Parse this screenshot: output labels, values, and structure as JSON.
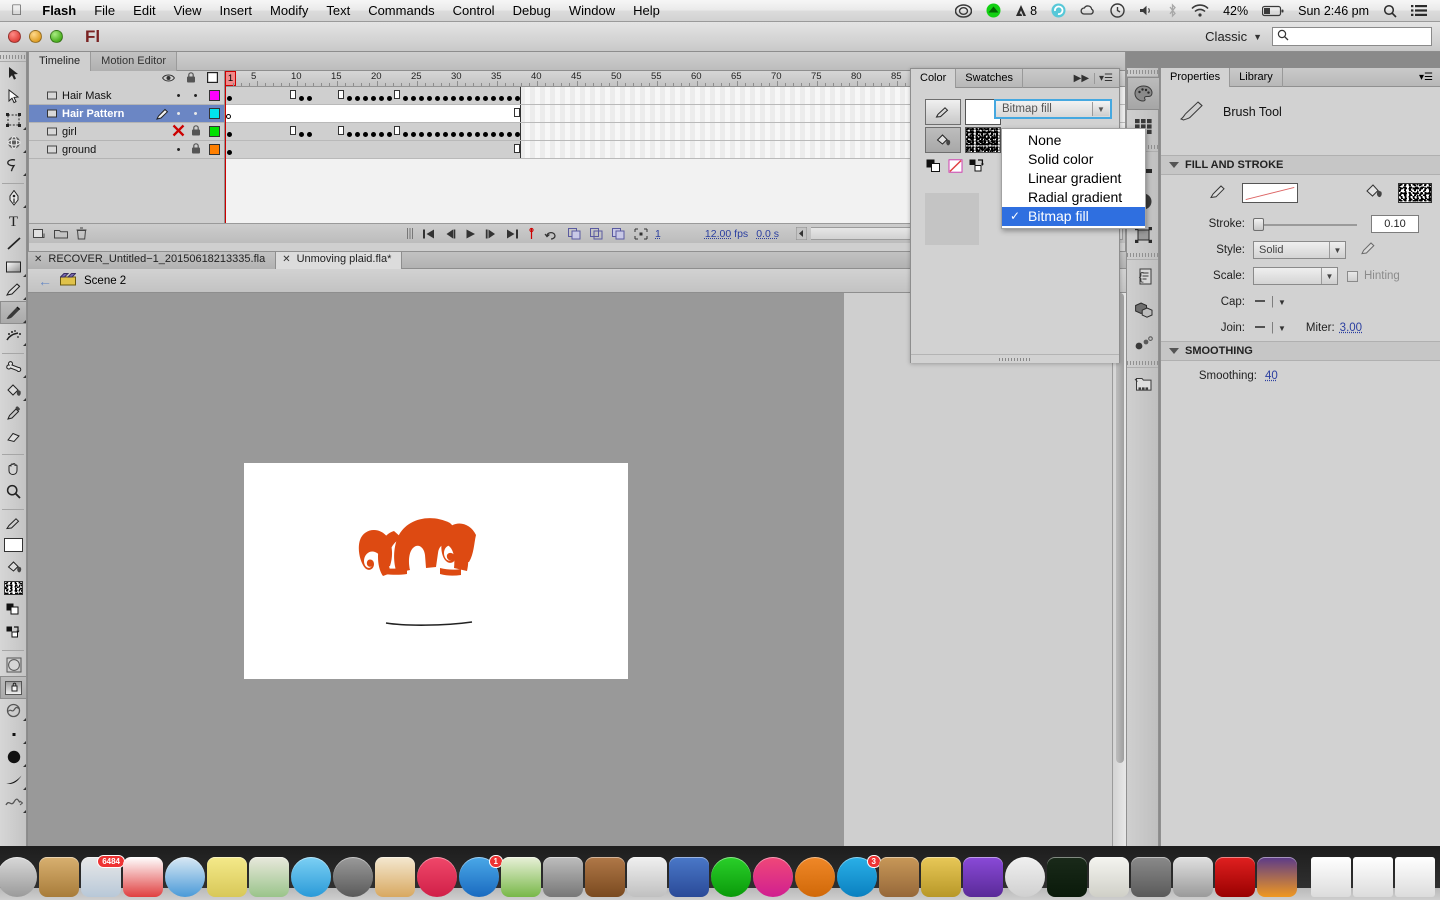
{
  "menubar": {
    "apple_icon": "apple-icon",
    "items": [
      "Flash",
      "File",
      "Edit",
      "View",
      "Insert",
      "Modify",
      "Text",
      "Commands",
      "Control",
      "Debug",
      "Window",
      "Help"
    ],
    "status": {
      "creative_cloud_icon": "creative-cloud-icon",
      "dropbox_icon": "dropbox-icon",
      "adobe_icon": "adobe-icon",
      "adobe_count": "8",
      "sync_icon": "sync-icon",
      "cloud_icon": "cloud-icon",
      "timemachine_icon": "time-machine-icon",
      "volume_icon": "volume-icon",
      "bluetooth_icon": "bluetooth-icon",
      "wifi_icon": "wifi-icon",
      "battery_percent": "42%",
      "battery_icon": "battery-icon",
      "clock": "Sun 2:46 pm",
      "spotlight_icon": "search-icon",
      "notification_icon": "notification-center-icon"
    }
  },
  "titlebar": {
    "app_logo": "Fl",
    "workspace": "Classic",
    "workspace_arrow_icon": "chevron-down-icon",
    "search_icon": "search-icon",
    "search_value": "",
    "search_placeholder": ""
  },
  "toolbar": {
    "tools": [
      {
        "name": "selection-tool",
        "icon": "arrow-icon",
        "selected": false,
        "submenu": false
      },
      {
        "name": "subselection-tool",
        "icon": "white-arrow-icon",
        "selected": false,
        "submenu": false
      },
      {
        "name": "free-transform-tool",
        "icon": "transform-icon",
        "selected": false,
        "submenu": true
      },
      {
        "name": "3d-rotation-tool",
        "icon": "sphere-icon",
        "selected": false,
        "submenu": true
      },
      {
        "name": "lasso-tool",
        "icon": "lasso-icon",
        "selected": false,
        "submenu": true
      },
      {
        "name": "pen-tool",
        "icon": "pen-nib-icon",
        "selected": false,
        "submenu": true
      },
      {
        "name": "text-tool",
        "icon": "text-t-icon",
        "selected": false,
        "submenu": false
      },
      {
        "name": "line-tool",
        "icon": "line-icon",
        "selected": false,
        "submenu": false
      },
      {
        "name": "rectangle-tool",
        "icon": "rectangle-icon",
        "selected": false,
        "submenu": true
      },
      {
        "name": "pencil-tool",
        "icon": "pencil-icon",
        "selected": false,
        "submenu": true
      },
      {
        "name": "brush-tool",
        "icon": "brush-icon",
        "selected": true,
        "submenu": true
      },
      {
        "name": "deco-tool",
        "icon": "deco-spray-icon",
        "selected": false,
        "submenu": true
      },
      {
        "name": "bone-tool",
        "icon": "bone-icon",
        "selected": false,
        "submenu": true
      },
      {
        "name": "paint-bucket-tool",
        "icon": "paint-bucket-icon",
        "selected": false,
        "submenu": true
      },
      {
        "name": "eyedropper-tool",
        "icon": "eyedropper-icon",
        "selected": false,
        "submenu": false
      },
      {
        "name": "eraser-tool",
        "icon": "eraser-icon",
        "selected": false,
        "submenu": false
      },
      {
        "name": "hand-tool",
        "icon": "hand-icon",
        "selected": false,
        "submenu": false
      },
      {
        "name": "zoom-tool",
        "icon": "magnifier-icon",
        "selected": false,
        "submenu": false
      }
    ],
    "colors": {
      "stroke_icon": "pencil-stroke-icon",
      "stroke_color": "#ffffff",
      "fill_icon": "paint-bucket-icon",
      "fill_swatch": "bitmap-fill-icon",
      "black_white_icon": "black-white-reset-icon",
      "swap_icon": "swap-colors-icon"
    },
    "options": {
      "object_drawing_icon": "object-drawing-icon",
      "lock_fill_icon": "lock-fill-icon",
      "brush_size_small_icon": "brush-size-small-icon",
      "brush_size_large_icon": "brush-size-large-icon",
      "brush_shape_icon": "brush-shape-icon",
      "smoothing_icon": "smoothing-icon"
    }
  },
  "timeline": {
    "tabs": [
      {
        "label": "Timeline",
        "active": true
      },
      {
        "label": "Motion Editor",
        "active": false
      }
    ],
    "header_icons": {
      "eye": "eye-icon",
      "lock": "lock-icon",
      "outline": "outline-square-icon"
    },
    "layers": [
      {
        "name": "Hair Mask",
        "visible": true,
        "locked": false,
        "color": "#ff00ff",
        "selected": false,
        "editing": false
      },
      {
        "name": "Hair Pattern",
        "visible": true,
        "locked": false,
        "color": "#00e5ee",
        "selected": true,
        "editing": true
      },
      {
        "name": "girl",
        "visible": false,
        "locked": true,
        "color": "#00e000",
        "selected": false,
        "editing": false
      },
      {
        "name": "ground",
        "visible": true,
        "locked": true,
        "color": "#ff7f00",
        "selected": false,
        "editing": false
      }
    ],
    "ruler_labels": [
      "1",
      "5",
      "10",
      "15",
      "20",
      "25",
      "30",
      "35",
      "40",
      "45",
      "50",
      "55",
      "60",
      "65",
      "70",
      "75",
      "80",
      "85"
    ],
    "playhead_frame": "1",
    "footer": {
      "new_layer_icon": "new-layer-icon",
      "new_folder_icon": "new-folder-icon",
      "delete_icon": "trash-icon",
      "first_frame_icon": "go-to-first-icon",
      "step_back_icon": "step-back-icon",
      "play_icon": "play-icon",
      "step_forward_icon": "step-forward-icon",
      "last_frame_icon": "go-to-last-icon",
      "center_frame_icon": "center-frame-icon",
      "loop_icon": "loop-icon",
      "onion_skin_icon": "onion-skin-icon",
      "onion_outline_icon": "onion-skin-outlines-icon",
      "edit_multiple_icon": "edit-multiple-frames-icon",
      "modify_markers_icon": "modify-onion-markers-icon",
      "current_frame": "1",
      "fps_value": "12.00",
      "fps_label": "fps",
      "elapsed": "0.0 s"
    }
  },
  "doctabs": [
    {
      "label": "RECOVER_Untitled−1_20150618213335.fla",
      "active": false,
      "close_icon": "close-icon"
    },
    {
      "label": "Unmoving plaid.fla*",
      "active": true,
      "close_icon": "close-icon"
    }
  ],
  "scenebar": {
    "back_icon": "back-arrow-icon",
    "scene_icon": "scene-clapper-icon",
    "scene_label": "Scene 2"
  },
  "stage": {
    "artwork_color": "#dd4a12",
    "ground_line_color": "#222222"
  },
  "color_panel": {
    "tabs": [
      {
        "label": "Color",
        "active": true
      },
      {
        "label": "Swatches",
        "active": false
      }
    ],
    "expand_icon": "double-chevron-right-icon",
    "menu_icon": "panel-menu-icon",
    "stroke_button_icon": "pencil-stroke-icon",
    "stroke_swatch_color": "#ffffff",
    "fill_button_icon": "paint-bucket-icon",
    "fill_swatch_icon": "bitmap-fill-icon",
    "reset_icon": "black-white-reset-icon",
    "nocolor_icon": "no-color-icon",
    "swap_icon": "swap-colors-icon",
    "fill_type_value": "Bitmap fill",
    "fill_type_arrow_icon": "chevron-down-icon",
    "dropdown_options": [
      {
        "label": "None",
        "checked": false
      },
      {
        "label": "Solid color",
        "checked": false
      },
      {
        "label": "Linear gradient",
        "checked": false
      },
      {
        "label": "Radial gradient",
        "checked": false
      },
      {
        "label": "Bitmap fill",
        "checked": true
      }
    ],
    "highlight_color": "#2f6fe0",
    "focus_border_color": "#45a8e0"
  },
  "icondock": [
    {
      "name": "color-panel-icon",
      "selected": true
    },
    {
      "name": "swatches-panel-icon",
      "selected": false
    },
    {
      "name": "align-panel-icon",
      "selected": false
    },
    {
      "name": "info-panel-icon",
      "selected": false
    },
    {
      "name": "transform-panel-icon",
      "selected": false
    },
    {
      "name": "code-snippets-icon",
      "selected": false
    },
    {
      "name": "components-panel-icon",
      "selected": false
    },
    {
      "name": "motion-presets-icon",
      "selected": false
    },
    {
      "name": "library-panel-icon",
      "selected": false
    }
  ],
  "properties": {
    "tabs": [
      {
        "label": "Properties",
        "active": true
      },
      {
        "label": "Library",
        "active": false
      }
    ],
    "menu_icon": "panel-menu-icon",
    "tool_icon": "brush-icon",
    "tool_name": "Brush Tool",
    "sections": {
      "fill_and_stroke": {
        "title": "FILL AND STROKE",
        "collapse_icon": "triangle-down-icon",
        "stroke_icon": "pencil-stroke-icon",
        "stroke_swatch": "none-diagonal-icon",
        "fill_icon": "paint-bucket-icon",
        "fill_swatch": "bitmap-fill-icon",
        "rows": [
          {
            "label": "Stroke:",
            "value": "0.10",
            "type": "slider-field"
          },
          {
            "label": "Style:",
            "value": "Solid",
            "type": "select",
            "edit_icon": "pencil-edit-icon"
          },
          {
            "label": "Scale:",
            "value": "",
            "type": "select",
            "checkbox_label": "Hinting",
            "checked": false
          },
          {
            "label": "Cap:",
            "value": "",
            "type": "icon-select",
            "icon": "cap-none-icon"
          },
          {
            "label": "Join:",
            "value": "",
            "type": "icon-select",
            "icon": "join-none-icon",
            "extra_label": "Miter:",
            "extra_value": "3.00"
          }
        ]
      },
      "smoothing": {
        "title": "SMOOTHING",
        "collapse_icon": "triangle-down-icon",
        "label": "Smoothing:",
        "value": "40"
      }
    }
  },
  "dock": {
    "items": [
      {
        "name": "finder-icon",
        "badge": null
      },
      {
        "name": "launchpad-icon",
        "badge": null
      },
      {
        "name": "contacts-icon",
        "badge": null
      },
      {
        "name": "mail-icon",
        "badge": "6484"
      },
      {
        "name": "calendar-icon",
        "badge": null
      },
      {
        "name": "safari-icon",
        "badge": null
      },
      {
        "name": "notes-icon",
        "badge": null
      },
      {
        "name": "maps-icon",
        "badge": null
      },
      {
        "name": "messages-icon",
        "badge": null
      },
      {
        "name": "facetime-icon",
        "badge": null
      },
      {
        "name": "pages-icon",
        "badge": null
      },
      {
        "name": "itunes-icon",
        "badge": null
      },
      {
        "name": "app-store-icon",
        "badge": "1"
      },
      {
        "name": "numbers-icon",
        "badge": null
      },
      {
        "name": "system-preferences-icon",
        "badge": null
      },
      {
        "name": "garageband-icon",
        "badge": null
      },
      {
        "name": "iphoto-icon",
        "badge": null
      },
      {
        "name": "keynote-icon",
        "badge": null
      },
      {
        "name": "dropbox-icon",
        "badge": null
      },
      {
        "name": "photoshop-elements-icon",
        "badge": null
      },
      {
        "name": "ibooks-icon",
        "badge": null
      },
      {
        "name": "skype-icon",
        "badge": "3"
      },
      {
        "name": "package-icon",
        "badge": null
      },
      {
        "name": "stuffit-icon",
        "badge": null
      },
      {
        "name": "imovie-icon",
        "badge": null
      },
      {
        "name": "chrome-icon",
        "badge": null
      },
      {
        "name": "activity-monitor-icon",
        "badge": null
      },
      {
        "name": "textedit-icon",
        "badge": null
      },
      {
        "name": "utility-icon",
        "badge": null
      },
      {
        "name": "neooffice-icon",
        "badge": null
      },
      {
        "name": "flash-icon",
        "badge": null
      },
      {
        "name": "audacity-icon",
        "badge": null
      }
    ],
    "stack_items": [
      {
        "name": "pdf-document-icon"
      },
      {
        "name": "finder-window-icon"
      },
      {
        "name": "finder-window-icon"
      }
    ],
    "trash_icon": "trash-icon"
  }
}
